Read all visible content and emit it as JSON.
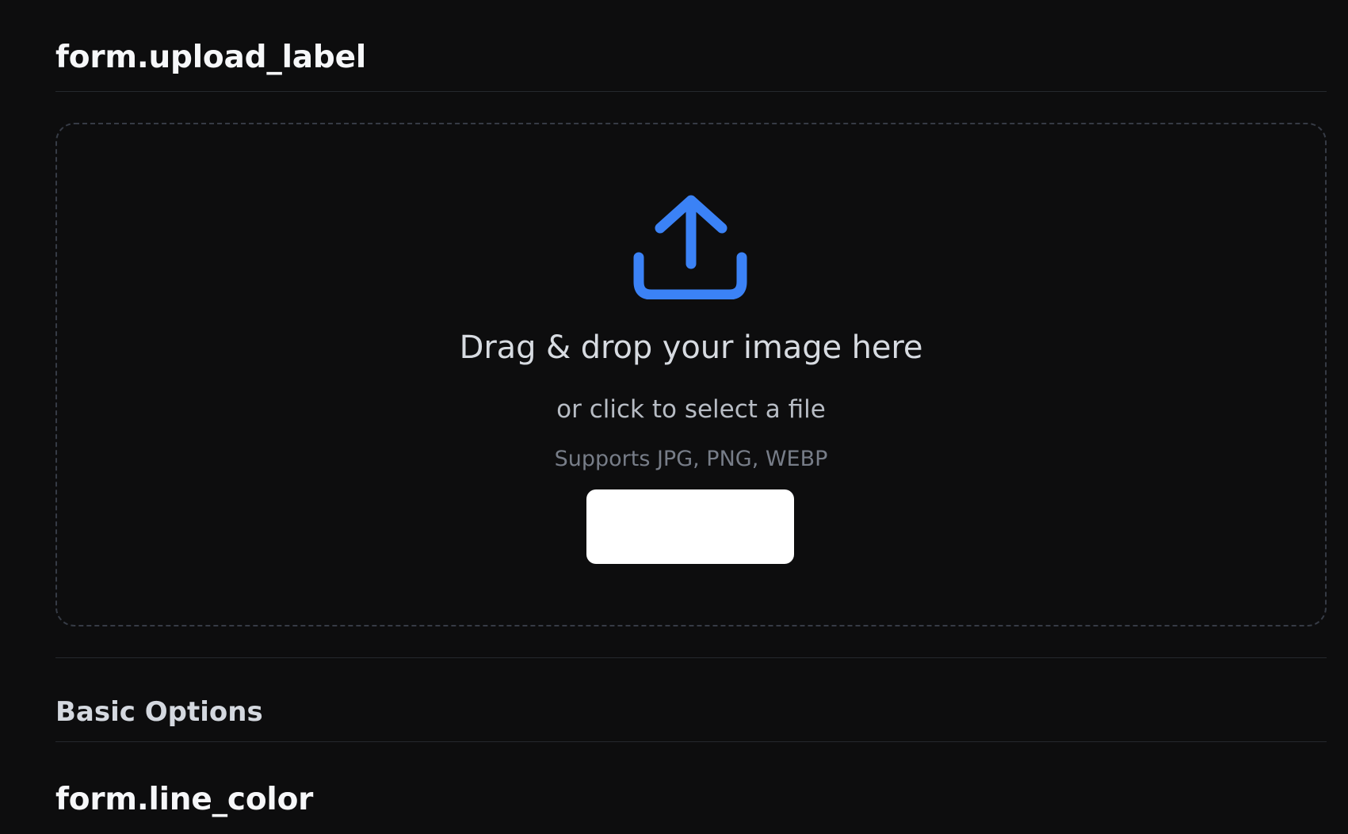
{
  "form": {
    "upload_label": "form.upload_label",
    "line_color_label": "form.line_color"
  },
  "upload": {
    "drag_text": "Drag & drop your image here",
    "click_text": "or click to select a file",
    "formats_text": "Supports JPG, PNG, WEBP",
    "select_button_label": "",
    "icon": "upload-icon"
  },
  "sections": {
    "basic_options": "Basic Options"
  },
  "colors": {
    "background": "#0d0d0e",
    "accent": "#3b82f6",
    "divider": "#25282d",
    "dashed_border": "#363b45",
    "button": "#ffffff"
  }
}
